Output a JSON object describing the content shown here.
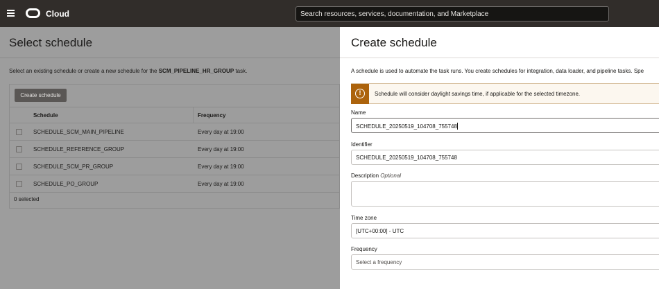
{
  "topbar": {
    "brand": "Cloud",
    "search_placeholder": "Search resources, services, documentation, and Marketplace"
  },
  "left": {
    "title": "Select schedule",
    "desc_prefix": "Select an existing schedule or create a new schedule for the",
    "desc_task": "SCM_PIPELINE_HR_GROUP",
    "desc_suffix": "task.",
    "create_button": "Create schedule",
    "columns": [
      "Schedule",
      "Frequency"
    ],
    "rows": [
      {
        "schedule": "SCHEDULE_SCM_MAIN_PIPELINE",
        "frequency": "Every day at 19:00"
      },
      {
        "schedule": "SCHEDULE_REFERENCE_GROUP",
        "frequency": "Every day at 19:00"
      },
      {
        "schedule": "SCHEDULE_SCM_PR_GROUP",
        "frequency": "Every day at 19:00"
      },
      {
        "schedule": "SCHEDULE_PO_GROUP",
        "frequency": "Every day at 19:00"
      }
    ],
    "selected_count": "0 selected"
  },
  "panel": {
    "title": "Create schedule",
    "description": "A schedule is used to automate the task runs. You create schedules for integration, data loader, and pipeline tasks. Spe",
    "warning": "Schedule will consider daylight savings time, if applicable for the selected timezone.",
    "name_label": "Name",
    "name_value": "SCHEDULE_20250519_104708_755748",
    "identifier_label": "Identifier",
    "identifier_value": "SCHEDULE_20250519_104708_755748",
    "description_label": "Description",
    "optional": "Optional",
    "timezone_label": "Time zone",
    "timezone_value": "[UTC+00:00] - UTC",
    "frequency_label": "Frequency",
    "frequency_placeholder": "Select a frequency"
  },
  "colors": {
    "topbar": "#312d2a",
    "warning_accent": "#ac630c",
    "overlay": "#9d9d9d"
  }
}
